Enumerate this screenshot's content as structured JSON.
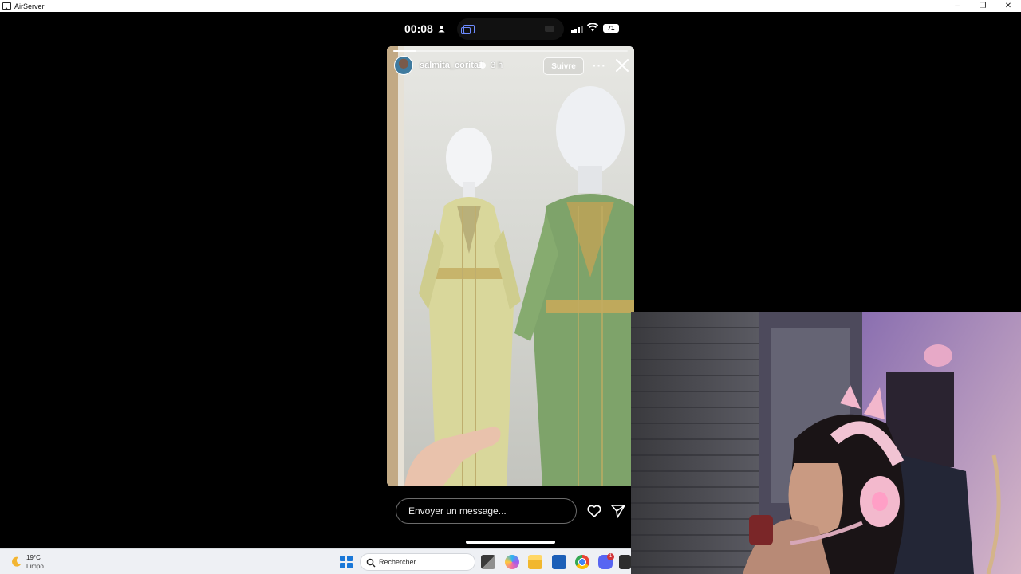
{
  "window": {
    "title": "AirServer",
    "minimize_glyph": "–",
    "restore_glyph": "❐",
    "close_glyph": "✕"
  },
  "phone": {
    "status_time": "00:08",
    "battery": "71",
    "story": {
      "username": "salmita_corita1",
      "time_ago": "3 h",
      "follow_label": "Suivre",
      "more_glyph": "···",
      "progress": 0.1
    },
    "reply_placeholder": "Envoyer un message..."
  },
  "taskbar": {
    "weather_temp": "19°C",
    "weather_desc": "Limpo",
    "search_placeholder": "Rechercher",
    "discord_badge": "1",
    "icons": [
      "start-icon",
      "task-view-icon",
      "copilot-icon",
      "file-explorer-icon",
      "store-icon",
      "chrome-icon",
      "discord-icon",
      "terminal-icon"
    ]
  },
  "colors": {
    "accent_blue": "#1a78d8",
    "dynamic_island_icon": "#6d8bff",
    "badge_red": "#d13438"
  }
}
